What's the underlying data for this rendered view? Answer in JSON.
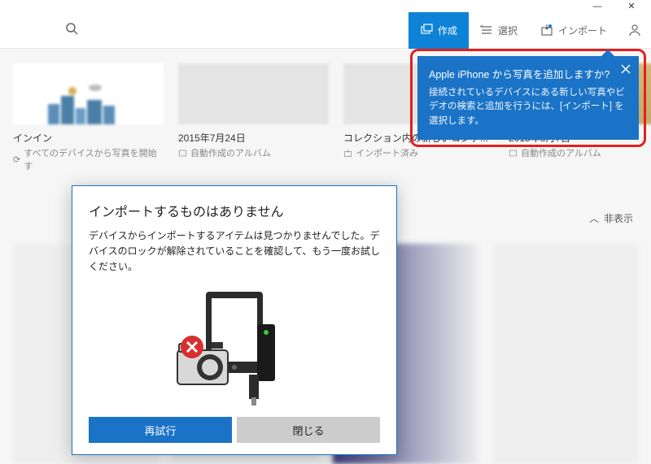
{
  "titlebar": {
    "minimize": "—",
    "close": "✕"
  },
  "toolbar": {
    "create": "作成",
    "select": "選択",
    "import": "インポート"
  },
  "cards": {
    "c0": {
      "title": "インイン",
      "sub": "すべてのデバイスから写真を開始す"
    },
    "c1": {
      "title": "2015年7月24日",
      "sub": "自動作成のアルバム"
    },
    "c2": {
      "title": "コレクション内の新しいコンテ...",
      "sub": "インポート済み"
    },
    "c3": {
      "title": "2015年8月7日",
      "sub": "自動作成のアルバム"
    }
  },
  "status": {
    "hide": "非表示"
  },
  "tooltip": {
    "title": "Apple iPhone から写真を追加しますか?",
    "body": "接続されているデバイスにある新しい写真やビデオの検索と追加を行うには、[インポート] を選択します。"
  },
  "dialog": {
    "title": "インポートするものはありません",
    "body": "デバイスからインポートするアイテムは見つかりませんでした。デバイスのロックが解除されていることを確認して、もう一度お試しください。",
    "retry": "再試行",
    "close": "閉じる"
  }
}
